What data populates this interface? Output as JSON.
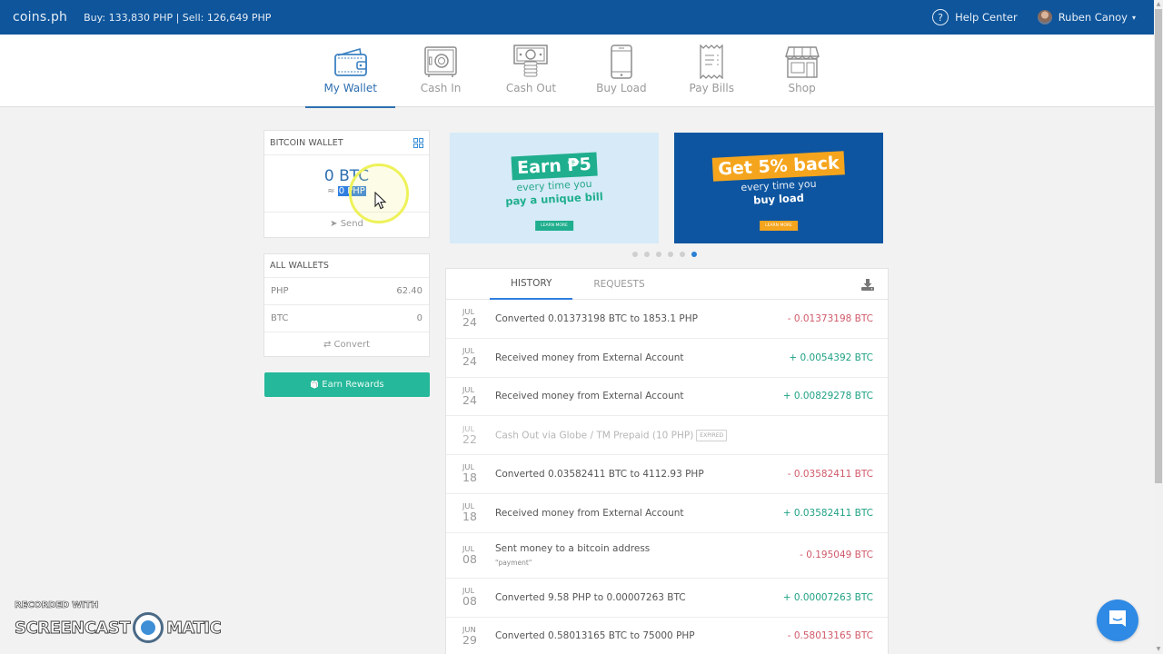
{
  "topbar": {
    "brand": "coins.ph",
    "rates": "Buy: 133,830 PHP | Sell: 126,649 PHP",
    "help_label": "Help Center",
    "help_icon": "?",
    "user_name": "Ruben Canoy",
    "caret": "▾"
  },
  "nav": {
    "items": [
      {
        "label": "My Wallet",
        "icon": "wallet-icon",
        "active": true
      },
      {
        "label": "Cash In",
        "icon": "safe-icon",
        "active": false
      },
      {
        "label": "Cash Out",
        "icon": "cash-icon",
        "active": false
      },
      {
        "label": "Buy Load",
        "icon": "phone-icon",
        "active": false
      },
      {
        "label": "Pay Bills",
        "icon": "receipt-icon",
        "active": false
      },
      {
        "label": "Shop",
        "icon": "store-icon",
        "active": false
      }
    ]
  },
  "bitcoin_wallet": {
    "title": "BITCOIN WALLET",
    "amount": "0 BTC",
    "approx_prefix": "≈ ",
    "php_value": "0 PHP",
    "send_label": "Send",
    "send_icon": "➤"
  },
  "all_wallets": {
    "title": "ALL WALLETS",
    "rows": [
      {
        "currency": "PHP",
        "balance": "62.40"
      },
      {
        "currency": "BTC",
        "balance": "0"
      }
    ],
    "convert_label": "Convert",
    "convert_icon": "⇄"
  },
  "earn_rewards": {
    "label": "Earn Rewards",
    "icon": "🎁"
  },
  "banners": [
    {
      "headline": "Earn ₱5",
      "line1": "every time you",
      "line2": "pay a unique bill",
      "button": "LEARN MORE"
    },
    {
      "headline": "Get 5% back",
      "line1": "every time you",
      "line2": "buy load",
      "button": "LEARN MORE"
    }
  ],
  "carousel": {
    "count": 6,
    "active_index": 5
  },
  "history": {
    "tabs": [
      {
        "label": "HISTORY",
        "active": true
      },
      {
        "label": "REQUESTS",
        "active": false
      }
    ],
    "transactions": [
      {
        "month": "JUL",
        "day": "24",
        "description": "Converted 0.01373198 BTC to 1853.1 PHP",
        "amount": "- 0.01373198 BTC",
        "direction": "neg"
      },
      {
        "month": "JUL",
        "day": "24",
        "description": "Received money from External Account",
        "amount": "+ 0.0054392 BTC",
        "direction": "pos"
      },
      {
        "month": "JUL",
        "day": "24",
        "description": "Received money from External Account",
        "amount": "+ 0.00829278 BTC",
        "direction": "pos"
      },
      {
        "month": "JUL",
        "day": "22",
        "description": "Cash Out via Globe / TM Prepaid (10 PHP)",
        "badge": "EXPIRED",
        "amount": "",
        "direction": "muted"
      },
      {
        "month": "JUL",
        "day": "18",
        "description": "Converted 0.03582411 BTC to 4112.93 PHP",
        "amount": "- 0.03582411 BTC",
        "direction": "neg"
      },
      {
        "month": "JUL",
        "day": "18",
        "description": "Received money from External Account",
        "amount": "+ 0.03582411 BTC",
        "direction": "pos"
      },
      {
        "month": "JUL",
        "day": "08",
        "description": "Sent money to a bitcoin address",
        "note": "\"payment\"",
        "amount": "- 0.195049 BTC",
        "direction": "neg"
      },
      {
        "month": "JUL",
        "day": "08",
        "description": "Converted 9.58 PHP to 0.00007263 BTC",
        "amount": "+ 0.00007263 BTC",
        "direction": "pos"
      },
      {
        "month": "JUN",
        "day": "29",
        "description": "Converted 0.58013165 BTC to 75000 PHP",
        "amount": "- 0.58013165 BTC",
        "direction": "neg"
      }
    ]
  },
  "watermark": {
    "line1": "RECORDED WITH",
    "left": "SCREENCAST",
    "right": "MATIC"
  },
  "colors": {
    "topbar": "#0e559b",
    "accent": "#2f6fb0",
    "positive": "#1fa184",
    "negative": "#d05a6a",
    "earn_button": "#25b89a"
  }
}
